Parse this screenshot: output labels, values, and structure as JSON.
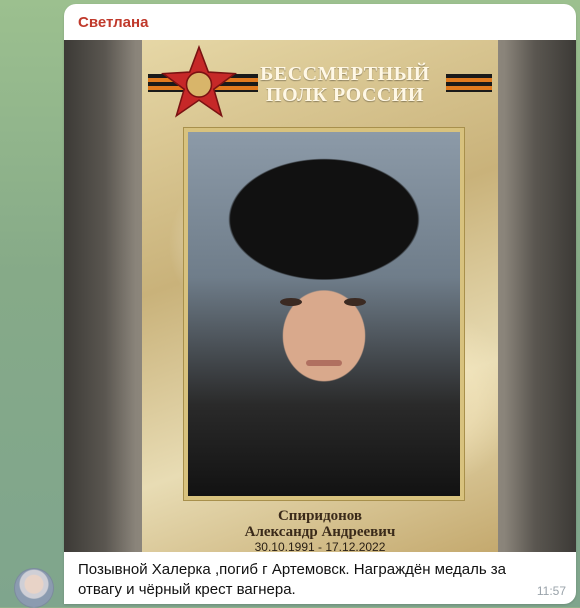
{
  "chat": {
    "sender": "Светлана",
    "message": {
      "caption": "Позывной Халерка ,погиб г Артемовск. Награждён медаль за отвагу и чёрный крест вагнера.",
      "time": "11:57"
    },
    "poster": {
      "title_line1": "БЕССМЕРТНЫЙ",
      "title_line2": "ПОЛК РОССИИ",
      "surname": "Спиридонов",
      "given_names": "Александр Андреевич",
      "dates": "30.10.1991 - 17.12.2022"
    }
  },
  "colors": {
    "sender": "#c0392b",
    "bubble": "#ffffff",
    "time": "#9aa3aa"
  },
  "icons": {
    "avatar": "user-avatar",
    "emblem": "red-star-emblem"
  }
}
